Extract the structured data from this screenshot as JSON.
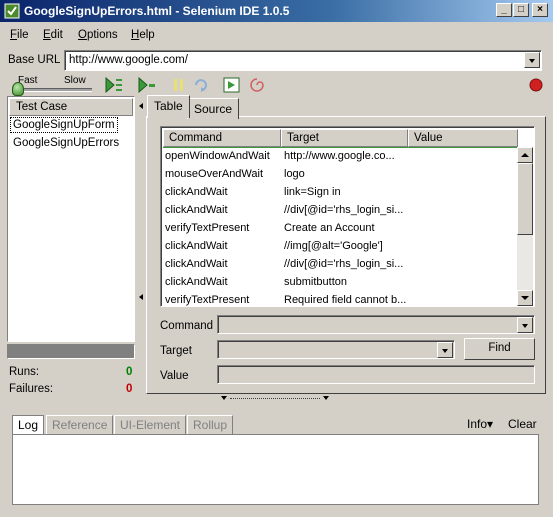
{
  "window": {
    "title": "GoogleSignUpErrors.html - Selenium IDE 1.0.5",
    "controls": {
      "minimize": "_",
      "maximize": "□",
      "close": "×"
    }
  },
  "menu": [
    {
      "label": "File",
      "u": "F",
      "rest": "ile"
    },
    {
      "label": "Edit",
      "u": "E",
      "rest": "dit"
    },
    {
      "label": "Options",
      "u": "O",
      "rest": "ptions"
    },
    {
      "label": "Help",
      "u": "H",
      "rest": "elp"
    }
  ],
  "base_url": {
    "label": "Base URL",
    "value": "http://www.google.com/"
  },
  "toolbar": {
    "speed_fast": "Fast",
    "speed_slow": "Slow",
    "icons": [
      "play-all-icon",
      "play-current-icon",
      "pause-icon",
      "step-icon",
      "testrunner-icon",
      "rollup-icon",
      "record-icon"
    ]
  },
  "test_cases": {
    "header": "Test Case",
    "items": [
      "GoogleSignUpForm",
      "GoogleSignUpErrors"
    ],
    "selected_index": 0
  },
  "stats": {
    "runs_label": "Runs:",
    "runs": "0",
    "failures_label": "Failures:",
    "failures": "0"
  },
  "tabs": {
    "table": "Table",
    "source": "Source"
  },
  "grid": {
    "columns": [
      "Command",
      "Target",
      "Value"
    ],
    "rows": [
      {
        "command": "openWindowAndWait",
        "target": "http://www.google.co...",
        "value": ""
      },
      {
        "command": "mouseOverAndWait",
        "target": "logo",
        "value": ""
      },
      {
        "command": "clickAndWait",
        "target": "link=Sign in",
        "value": ""
      },
      {
        "command": "clickAndWait",
        "target": "//div[@id='rhs_login_si...",
        "value": ""
      },
      {
        "command": "verifyTextPresent",
        "target": "Create an Account",
        "value": ""
      },
      {
        "command": "clickAndWait",
        "target": "//img[@alt='Google']",
        "value": ""
      },
      {
        "command": "clickAndWait",
        "target": "//div[@id='rhs_login_si...",
        "value": ""
      },
      {
        "command": "clickAndWait",
        "target": "submitbutton",
        "value": ""
      },
      {
        "command": "verifyTextPresent",
        "target": "Required field cannot b...",
        "value": ""
      }
    ]
  },
  "editor": {
    "command_label": "Command",
    "target_label": "Target",
    "value_label": "Value",
    "find_label": "Find"
  },
  "log": {
    "tabs": [
      "Log",
      "Reference",
      "UI-Element",
      "Rollup"
    ],
    "info_label": "Info▾",
    "clear_label": "Clear"
  },
  "colors": {
    "title_bar": "#0a246a",
    "runs_green": "#008000",
    "failures_red": "#c00000",
    "record_red": "#d02020"
  }
}
